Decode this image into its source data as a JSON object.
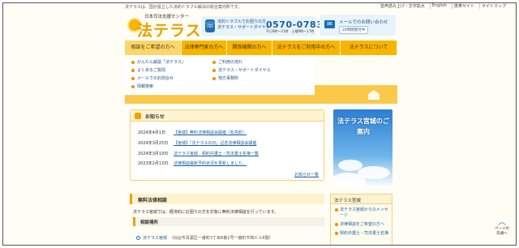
{
  "top": {
    "intro": "法テラスは、国が設立した法的トラブル解決の総合案内所です。",
    "links": [
      "音声読み上げ・文字拡大",
      "English",
      "携帯サイト",
      "サイトマップ"
    ]
  },
  "header": {
    "logo_sub": "日本司法支援センター",
    "logo_name": "法テラス",
    "phone_label_1": "法的トラブルでお困りの方",
    "phone_label_2": "法テラス・サポートダイヤル",
    "phone_number": "0570-078374",
    "phone_hours": "平日9時〜21時　土曜9時〜17時",
    "mail_text": "メールでのお問い合わせ",
    "mail_badge": "24時間受付中"
  },
  "nav": {
    "items": [
      {
        "label": "相談をご希望の方へ"
      },
      {
        "label": "法律専門家の方へ"
      },
      {
        "label": "関係機関の方へ"
      },
      {
        "label": "法テラスをご利用中の方へ"
      },
      {
        "label": "法テラスについて"
      }
    ]
  },
  "dropdown": {
    "left": [
      "かんたん解説「法テラス」",
      "よくあるご質問",
      "メールでのお問合せ",
      "情報検索"
    ],
    "right": [
      "ご利用の流れ",
      "法テラス・サポートダイヤル",
      "地方事務所"
    ]
  },
  "notice": {
    "title": "お知らせ",
    "items": [
      {
        "date": "2024年4月1日",
        "text": "【宮城】無料法律相談会開催（松島町）"
      },
      {
        "date": "2024年3月25日",
        "text": "【宮城】「法テラスの日」記念法律相談会開催"
      },
      {
        "date": "2024年3月19日",
        "text": "法テラス宮城　契約弁護士・司法書士名簿一覧"
      },
      {
        "date": "2023年2月13日",
        "text": "法律相談最新予約状況を更新しました。"
      }
    ],
    "more": "お知らせ一覧"
  },
  "consult": {
    "title": "無料法律相談",
    "desc": "法テラス宮城では、経済的にお困りの方を対象に無料法律相談を行っています。",
    "place_title": "相談場所",
    "place_name": "法テラス宮城",
    "place_addr": "（仙台市青葉区一番町3丁目6番1号一番町平和ビル6階）"
  },
  "sidebar": {
    "banner": "法テラス宮城のご案内",
    "box_title": "法テラス宮城",
    "items": [
      "法テラス宮城からのメッセージ",
      "法律相談をご希望の方へ",
      "契約弁護士・司法書士名簿"
    ]
  },
  "totop": {
    "arrow": "︿",
    "label_1": "ページの",
    "label_2": "先頭へ"
  }
}
